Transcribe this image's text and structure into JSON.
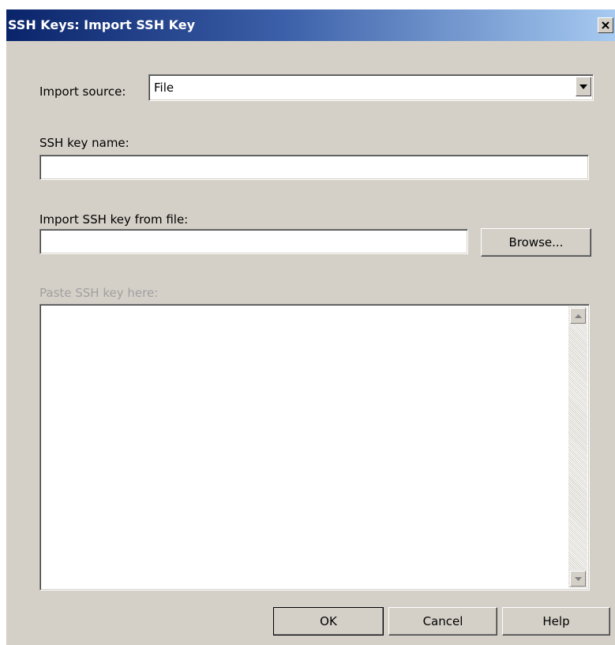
{
  "window": {
    "title": "SSH Keys: Import SSH Key",
    "close_icon": "close-icon"
  },
  "form": {
    "import_source": {
      "label": "Import source:",
      "selected": "File"
    },
    "key_name": {
      "label": "SSH key name:",
      "value": ""
    },
    "key_file": {
      "label": "Import SSH key from file:",
      "value": "",
      "browse_label": "Browse..."
    },
    "paste": {
      "label": "Paste SSH key here:",
      "value": "",
      "disabled": true
    }
  },
  "buttons": {
    "ok": "OK",
    "cancel": "Cancel",
    "help": "Help"
  },
  "colors": {
    "dialog_bg": "#d4d0c8",
    "titlebar_start": "#0a246a",
    "titlebar_end": "#a6caf0",
    "disabled_text": "#a0a0a0"
  }
}
